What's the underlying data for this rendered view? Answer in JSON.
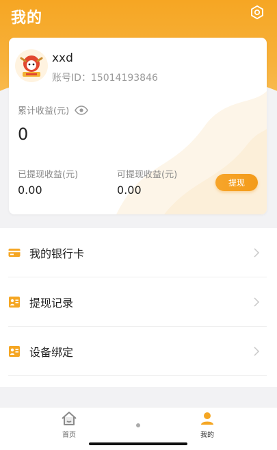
{
  "header": {
    "title": "我的",
    "settings_icon": "settings-icon"
  },
  "profile": {
    "username": "xxd",
    "account_id_label": "账号ID：",
    "account_id": "15014193846",
    "account_id_text": "账号ID：15014193846"
  },
  "earnings": {
    "total_label": "累计收益(元)",
    "total_value": "0",
    "withdrawn_label": "已提现收益(元)",
    "withdrawn_value": "0.00",
    "available_label": "可提现收益(元)",
    "available_value": "0.00",
    "withdraw_button": "提现"
  },
  "menu": {
    "items": [
      {
        "label": "我的银行卡",
        "icon": "bank-card-icon"
      },
      {
        "label": "提现记录",
        "icon": "record-icon"
      },
      {
        "label": "设备绑定",
        "icon": "device-icon"
      }
    ]
  },
  "tabbar": {
    "tabs": [
      {
        "label": "首页",
        "icon": "home-icon",
        "active": false
      },
      {
        "label": "我的",
        "icon": "user-icon",
        "active": true
      }
    ]
  },
  "colors": {
    "accent": "#f6a623",
    "text_primary": "#222222",
    "text_secondary": "#888888",
    "tab_inactive": "#666666",
    "tab_active": "#333333"
  }
}
